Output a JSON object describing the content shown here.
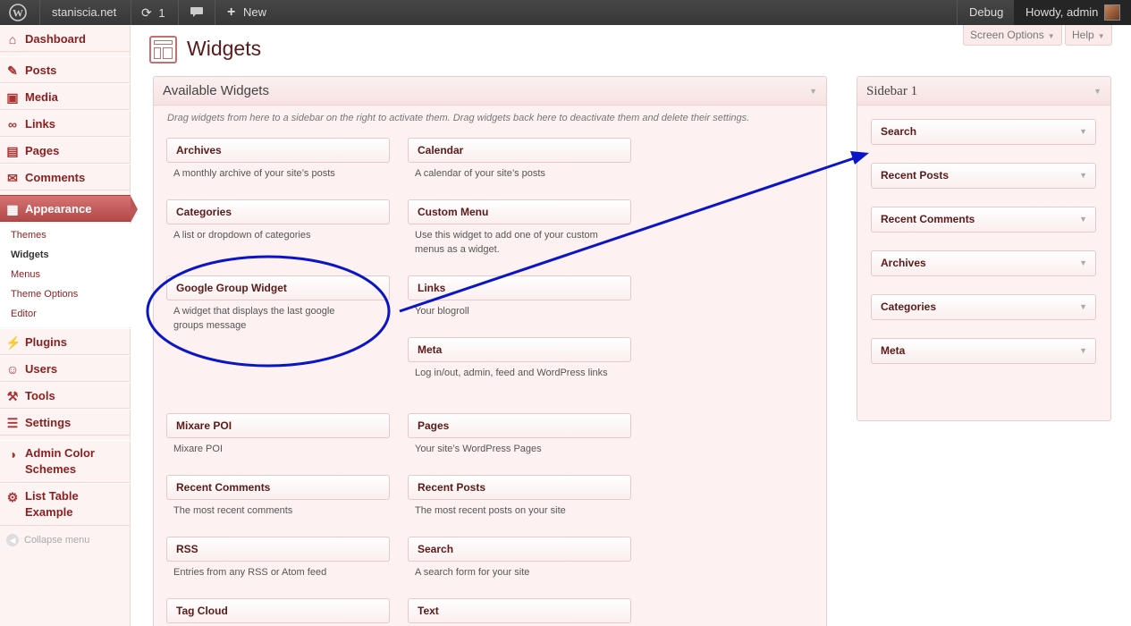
{
  "admin_bar": {
    "site_name": "staniscia.net",
    "updates_count": "1",
    "new_label": "New",
    "debug_label": "Debug",
    "howdy": "Howdy, admin"
  },
  "menu": {
    "dashboard": "Dashboard",
    "posts": "Posts",
    "media": "Media",
    "links": "Links",
    "pages": "Pages",
    "comments": "Comments",
    "appearance": "Appearance",
    "appearance_sub": [
      "Themes",
      "Widgets",
      "Menus",
      "Theme Options",
      "Editor"
    ],
    "plugins": "Plugins",
    "users": "Users",
    "tools": "Tools",
    "settings": "Settings",
    "admin_color_line1": "Admin Color",
    "admin_color_line2": "Schemes",
    "list_table_line1": "List Table",
    "list_table_line2": "Example",
    "collapse": "Collapse menu"
  },
  "page": {
    "title": "Widgets",
    "screen_options": "Screen Options",
    "help": "Help"
  },
  "available": {
    "title": "Available Widgets",
    "hint": "Drag widgets from here to a sidebar on the right to activate them. Drag widgets back here to deactivate them and delete their settings.",
    "widgets": [
      {
        "name": "Archives",
        "desc": "A monthly archive of your site’s posts"
      },
      {
        "name": "Calendar",
        "desc": "A calendar of your site’s posts"
      },
      {
        "name": "Categories",
        "desc": "A list or dropdown of categories"
      },
      {
        "name": "Custom Menu",
        "desc": "Use this widget to add one of your custom menus as a widget."
      },
      {
        "name": "Google Group Widget",
        "desc": "A widget that displays the last google groups message"
      },
      {
        "name": "Links",
        "desc": "Your blogroll"
      },
      {
        "name": "Meta",
        "desc": "Log in/out, admin, feed and WordPress links"
      },
      {
        "name": "Mixare POI",
        "desc": "Mixare POI"
      },
      {
        "name": "Pages",
        "desc": "Your site’s WordPress Pages"
      },
      {
        "name": "Recent Comments",
        "desc": "The most recent comments"
      },
      {
        "name": "Recent Posts",
        "desc": "The most recent posts on your site"
      },
      {
        "name": "RSS",
        "desc": "Entries from any RSS or Atom feed"
      },
      {
        "name": "Search",
        "desc": "A search form for your site"
      },
      {
        "name": "Tag Cloud",
        "desc": ""
      },
      {
        "name": "Text",
        "desc": ""
      }
    ]
  },
  "sidebar1": {
    "title": "Sidebar 1",
    "widgets": [
      "Search",
      "Recent Posts",
      "Recent Comments",
      "Archives",
      "Categories",
      "Meta"
    ]
  },
  "colors": {
    "accent": "#b24a4a",
    "annotation": "#0a14c8"
  }
}
